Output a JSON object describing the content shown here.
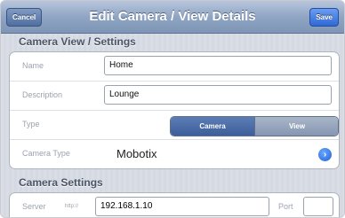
{
  "navbar": {
    "title": "Edit Camera / View Details",
    "cancel_label": "Cancel",
    "save_label": "Save"
  },
  "sections": {
    "view_settings_header": "Camera View / Settings",
    "camera_settings_header": "Camera Settings"
  },
  "fields": {
    "name_label": "Name",
    "name_value": "Home",
    "description_label": "Description",
    "description_value": "Lounge",
    "type_label": "Type",
    "type_options": [
      "Camera",
      "View"
    ],
    "type_selected": "Camera",
    "camera_type_label": "Camera Type",
    "camera_type_value": "Mobotix",
    "server_label": "Server",
    "server_prefix": "http://",
    "server_value": "192.168.1.10",
    "port_label": "Port",
    "port_value": ""
  },
  "icons": {
    "disclosure": "chevron-right-icon"
  },
  "colors": {
    "navbar": "#8fa5c3",
    "save_button": "#2f69d6",
    "segment_active": "#3c5e99"
  }
}
